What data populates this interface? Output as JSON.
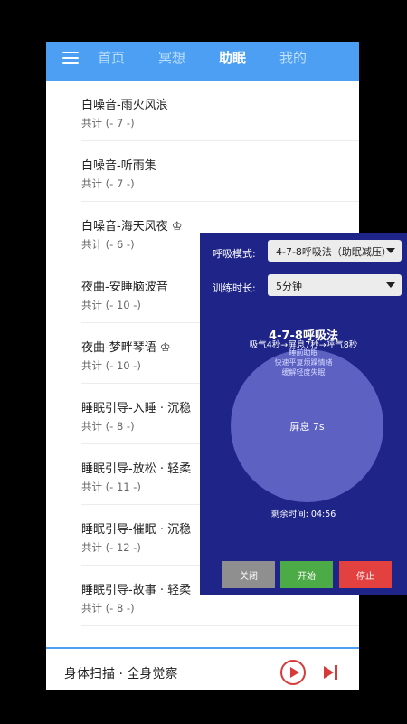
{
  "nav": {
    "tabs": [
      {
        "label": "首页",
        "active": false
      },
      {
        "label": "冥想",
        "active": false
      },
      {
        "label": "助眠",
        "active": true
      },
      {
        "label": "我的",
        "active": false
      }
    ]
  },
  "list": {
    "items": [
      {
        "title": "白噪音-雨火风浪",
        "count": "共计 (- 7 -)"
      },
      {
        "title": "白噪音-听雨集",
        "count": "共计 (- 7 -)"
      },
      {
        "title": "白噪音-海天风夜 ♔",
        "count": "共计 (- 6 -)"
      },
      {
        "title": "夜曲-安睡脑波音",
        "count": "共计 (- 10 -)"
      },
      {
        "title": "夜曲-梦畔琴语 ♔",
        "count": "共计 (- 10 -)"
      },
      {
        "title": "睡眠引导-入睡 · 沉稳",
        "count": "共计 (- 8 -)"
      },
      {
        "title": "睡眠引导-放松 · 轻柔",
        "count": "共计 (- 11 -)"
      },
      {
        "title": "睡眠引导-催眠 · 沉稳",
        "count": "共计 (- 12 -)"
      },
      {
        "title": "睡眠引导-故事 · 轻柔",
        "count": "共计 (- 8 -)"
      }
    ]
  },
  "player": {
    "title": "身体扫描 · 全身觉察"
  },
  "breathing": {
    "mode_label": "呼吸模式:",
    "mode_value": "4-7-8呼吸法（助眠减压）",
    "duration_label": "训练时长:",
    "duration_value": "5分钟",
    "method_name": "4-7-8呼吸法",
    "method_steps": "吸气4秒→屏息7秒→呼气8秒",
    "benefits": [
      "睡前助眠",
      "快速平复烦躁情绪",
      "缓解轻度失眠"
    ],
    "phase": "屏息 7s",
    "remaining": "剩余时间: 04:56",
    "buttons": {
      "close": "关闭",
      "start": "开始",
      "stop": "停止"
    }
  },
  "colors": {
    "topbar": "#4d9ff3",
    "overlay": "#1e2488",
    "circle": "#5c61c2",
    "close": "#8f8f8f",
    "start": "#4caa47",
    "stop": "#e34040",
    "player_accent": "#d83a3a"
  }
}
